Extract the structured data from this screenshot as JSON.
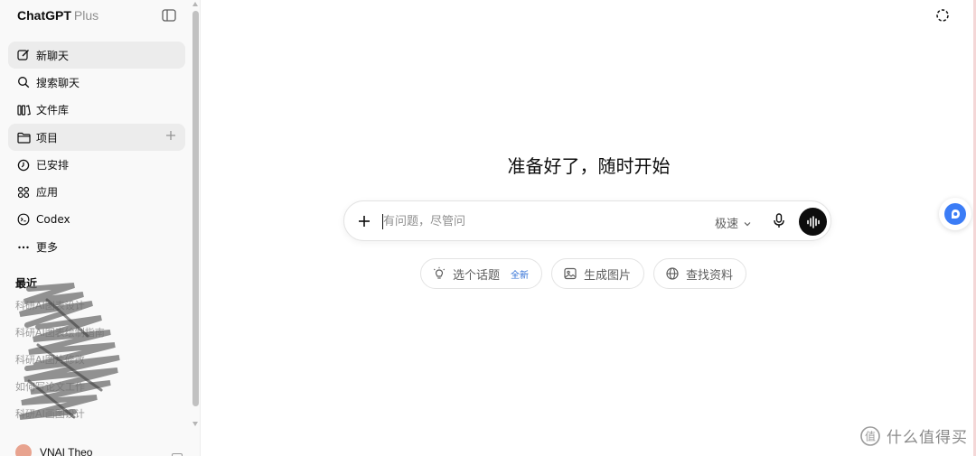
{
  "sidebar": {
    "brand": "ChatGPT",
    "plan": "Plus",
    "nav": [
      {
        "label": "新聊天",
        "icon": "edit-icon"
      },
      {
        "label": "搜索聊天",
        "icon": "search-icon"
      },
      {
        "label": "文件库",
        "icon": "library-icon"
      },
      {
        "label": "项目",
        "icon": "folder-icon"
      },
      {
        "label": "已安排",
        "icon": "clock-icon"
      },
      {
        "label": "应用",
        "icon": "apps-grid-icon"
      },
      {
        "label": "Codex",
        "icon": "codex-icon"
      },
      {
        "label": "更多",
        "icon": "more-icon"
      }
    ],
    "recent_title": "最近",
    "recent_items": [
      "科研AI图表设计",
      "科研AI图表绘制指南",
      "科研AI图片修改",
      "如何写论文工作",
      "科研AI画图设计"
    ],
    "user_name": "VNAI Theo"
  },
  "main": {
    "headline": "准备好了，随时开始",
    "composer": {
      "placeholder": "有问题，尽管问",
      "model": "极速"
    },
    "chips": [
      {
        "label": "选个话题",
        "icon": "lightbulb-icon",
        "badge": "全新"
      },
      {
        "label": "生成图片",
        "icon": "image-icon"
      },
      {
        "label": "查找资料",
        "icon": "globe-icon"
      }
    ]
  },
  "watermark": "什么值得买",
  "colors": {
    "accent_blue": "#3b7cf6",
    "badge_blue": "#2f6fd6",
    "sidebar_bg": "#f9f9f9",
    "voice_button": "#0d0d0d"
  }
}
